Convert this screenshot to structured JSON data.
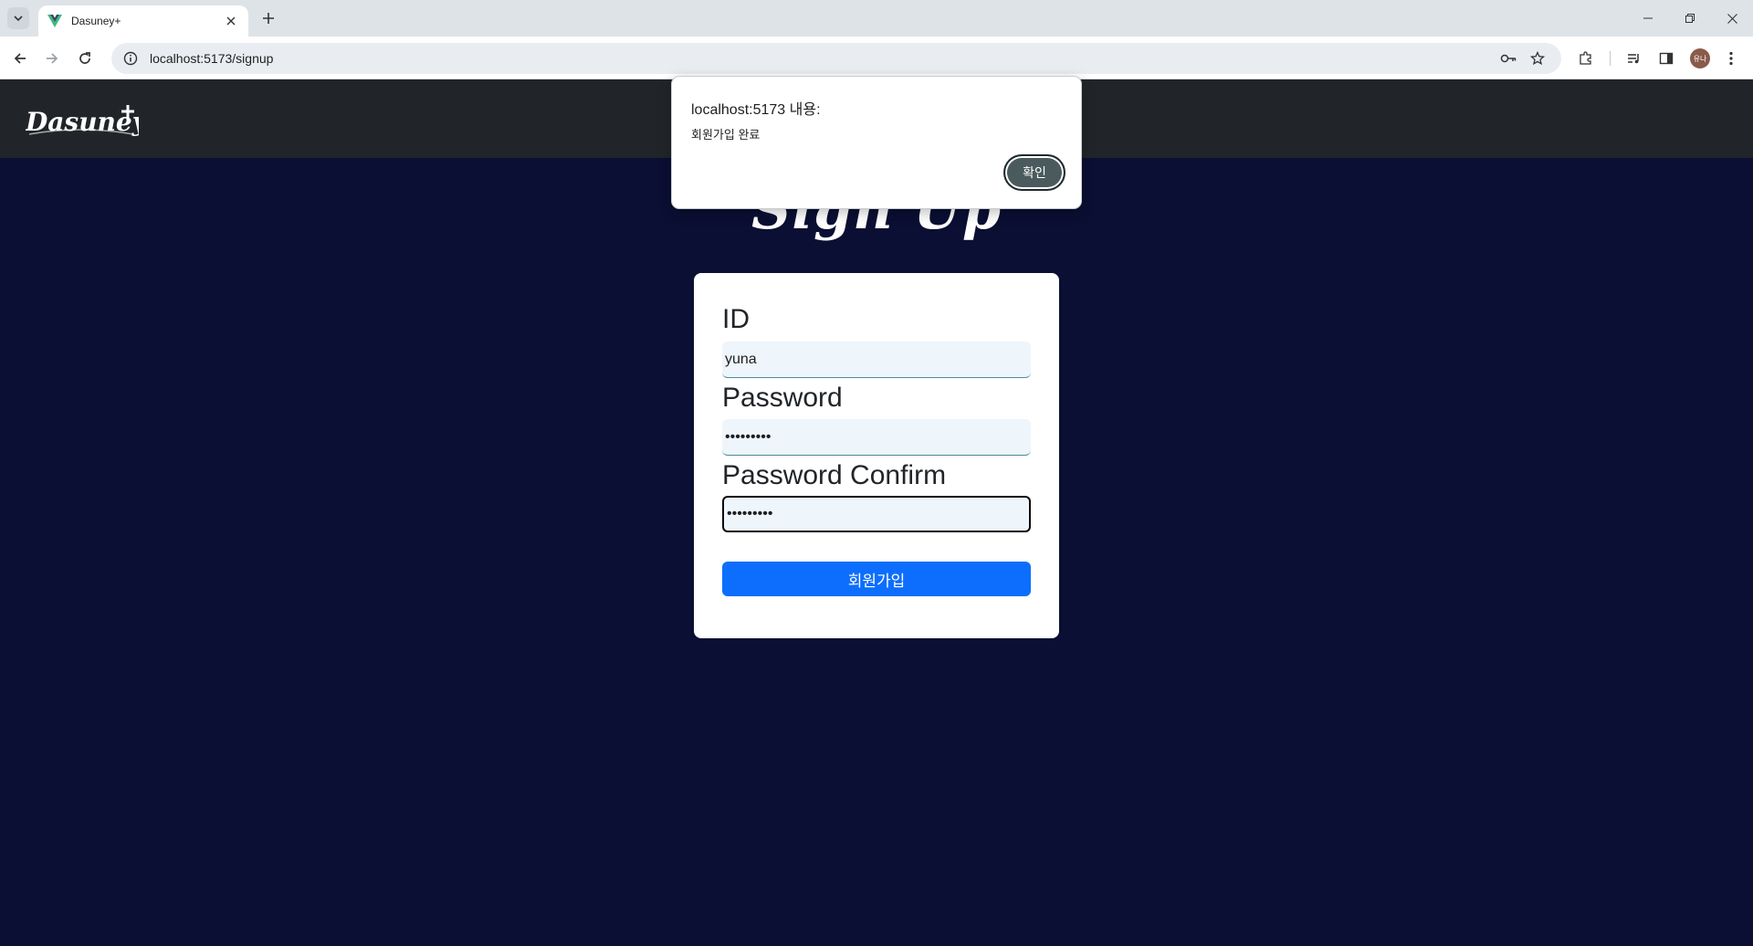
{
  "browser": {
    "tab_title": "Dasuney+",
    "url": "localhost:5173/signup"
  },
  "header": {
    "logo_text": "Dasuney+"
  },
  "page": {
    "title": "Sign Up"
  },
  "form": {
    "id_label": "ID",
    "id_value": "yuna",
    "password_label": "Password",
    "password_value": "•••••••••",
    "password_confirm_label": "Password Confirm",
    "password_confirm_value": "•••••••••",
    "submit_label": "회원가입"
  },
  "dialog": {
    "origin": "localhost:5173 내용:",
    "message": "회원가입 완료",
    "ok_label": "확인"
  },
  "colors": {
    "page_bg": "#0a0f33",
    "header_bg": "#212529",
    "primary": "#0d6efd"
  }
}
